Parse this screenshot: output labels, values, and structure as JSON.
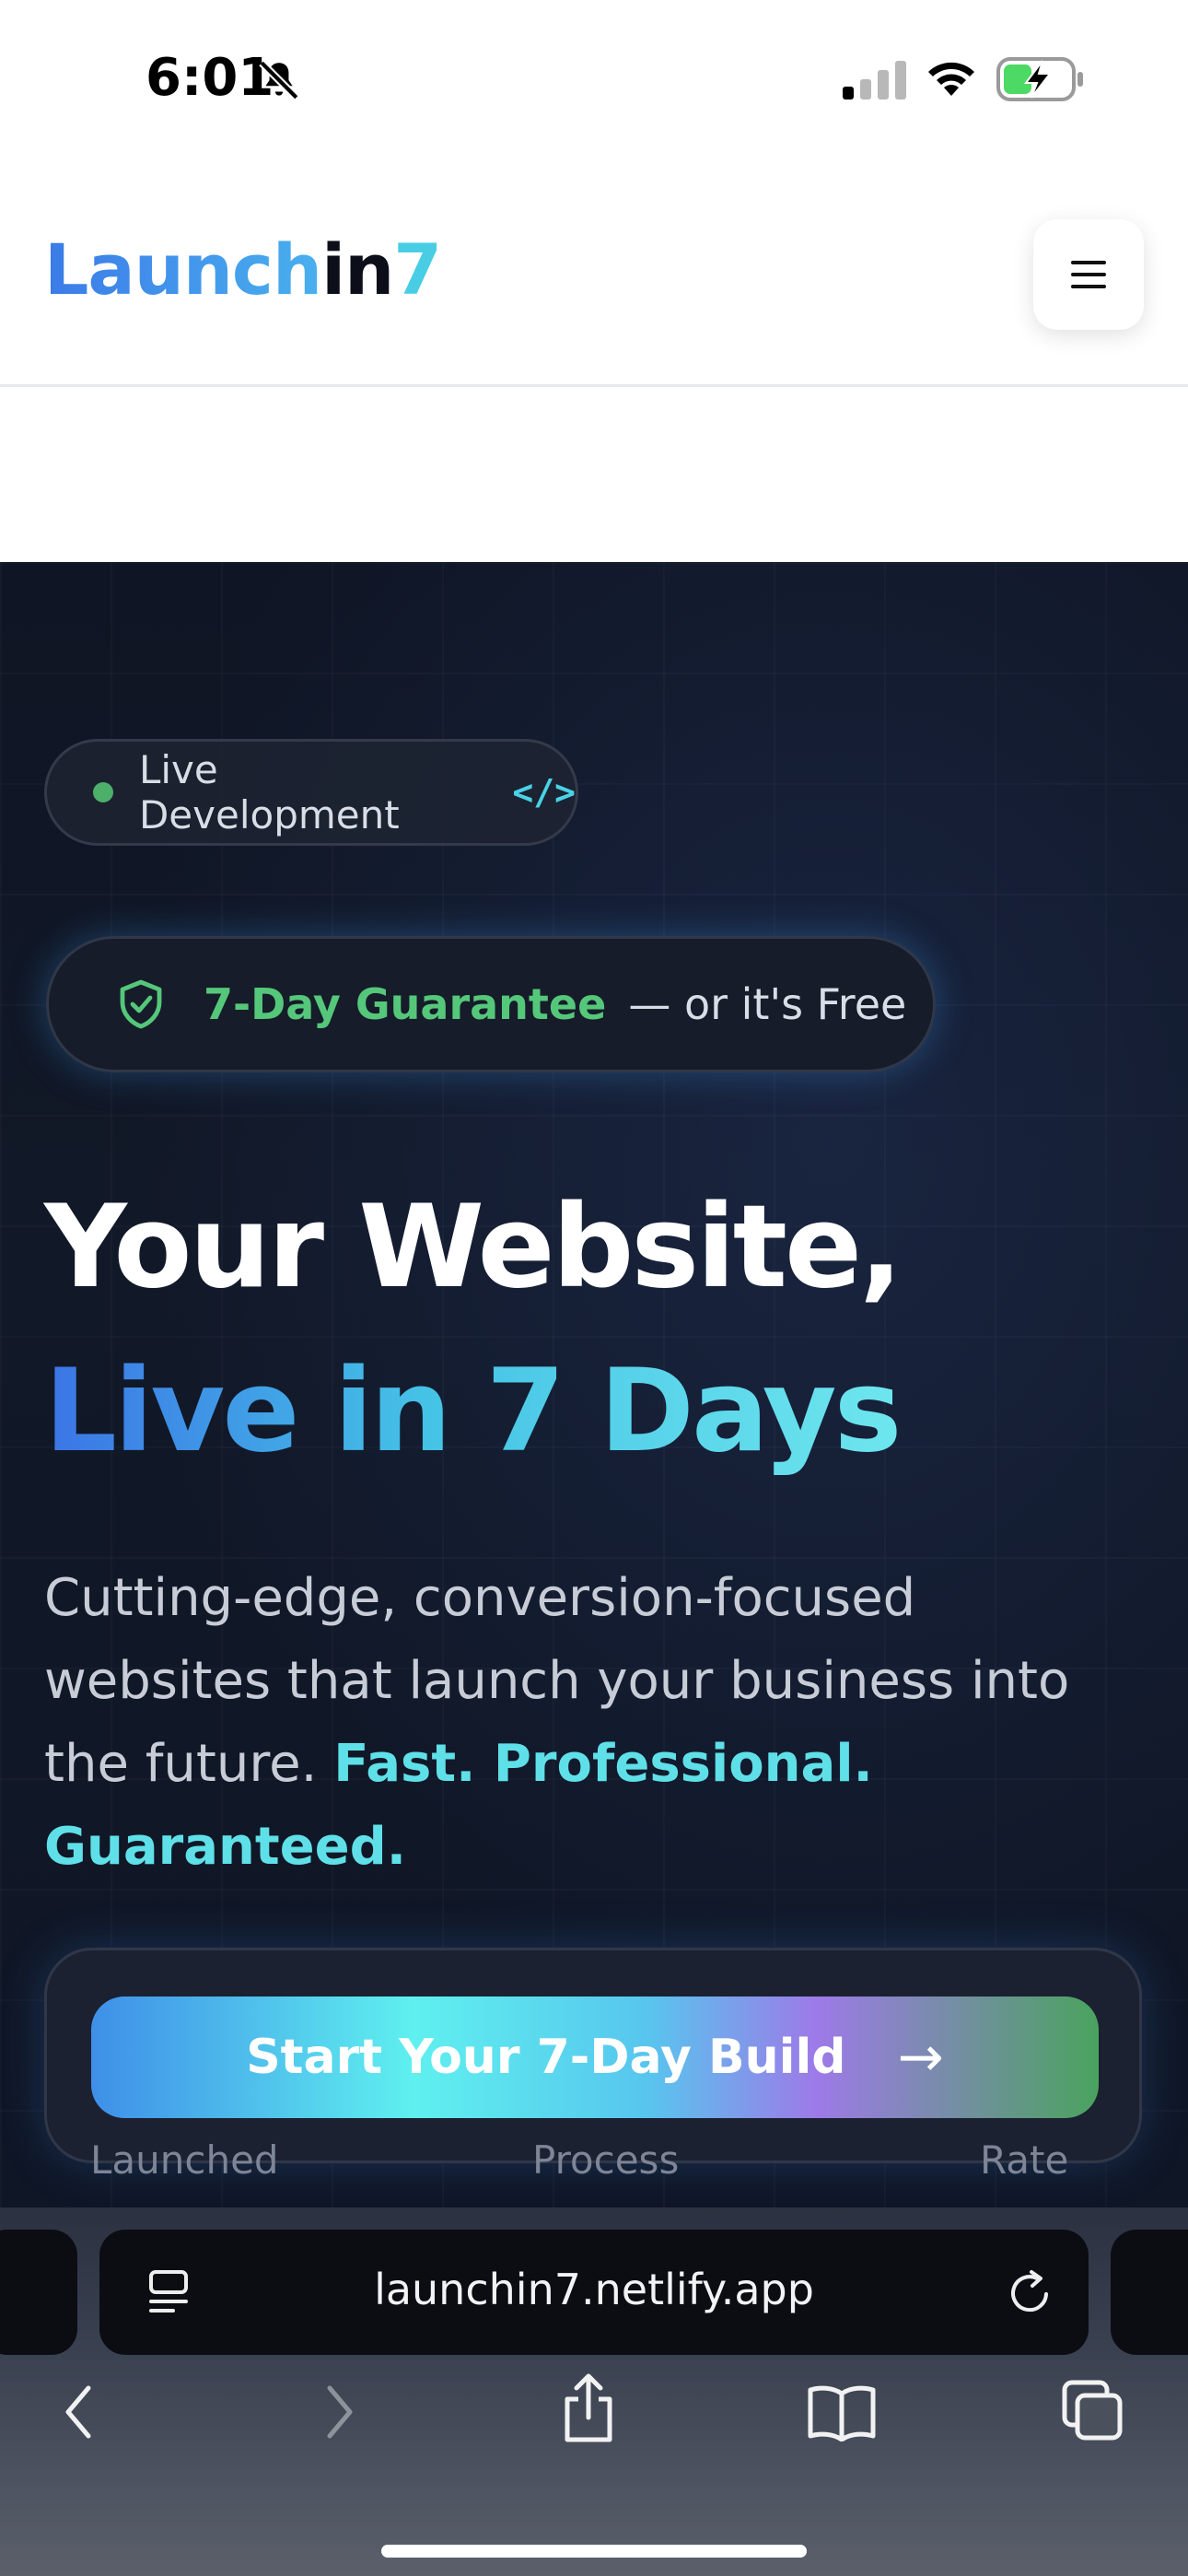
{
  "status_bar": {
    "time": "6:01",
    "icons": [
      "bell-slash-icon",
      "cellular-signal-icon",
      "wifi-icon",
      "battery-charging-icon"
    ]
  },
  "header": {
    "logo": {
      "part1": "Launch",
      "part2": "in",
      "part3": "7"
    },
    "menu_icon": "hamburger-menu-icon"
  },
  "hero": {
    "live_badge": {
      "label": "Live Development",
      "icon": "</>"
    },
    "guarantee_badge": {
      "highlight": "7-Day Guarantee",
      "suffix": "— or it's Free",
      "icon": "shield-check-icon"
    },
    "headline_line1": "Your Website,",
    "headline_line2": "Live in 7 Days",
    "description": "Cutting-edge, conversion-focused websites that launch your business into the future.",
    "description_highlight": "Fast. Professional. Guaranteed.",
    "cta": {
      "label": "Start Your 7-Day Build",
      "arrow": "→"
    },
    "stat_labels": [
      "Launched",
      "Process",
      "Rate"
    ]
  },
  "browser": {
    "url": "launchin7.netlify.app",
    "toolbar_icons": [
      "back-icon",
      "forward-icon",
      "share-icon",
      "bookmarks-icon",
      "tabs-icon"
    ]
  },
  "colors": {
    "hero_bg": "#111827",
    "accent_cyan": "#5fe0e8",
    "accent_green": "#55c77a",
    "accent_blue": "#3b74e6"
  }
}
